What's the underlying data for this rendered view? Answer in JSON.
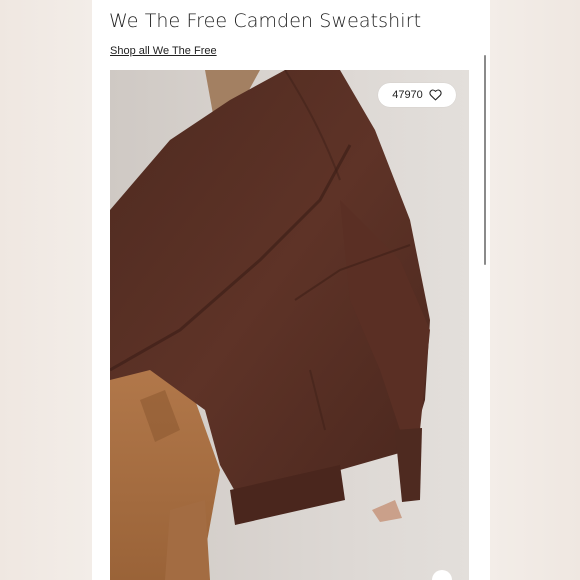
{
  "product": {
    "title": "We The Free Camden Sweatshirt",
    "shop_link": "Shop all We The Free",
    "likes_count": "47970"
  },
  "icons": {
    "heart": "heart-icon"
  },
  "colors": {
    "sweatshirt": "#5a3025",
    "pants": "#b0764a",
    "background": "#ffffff"
  }
}
